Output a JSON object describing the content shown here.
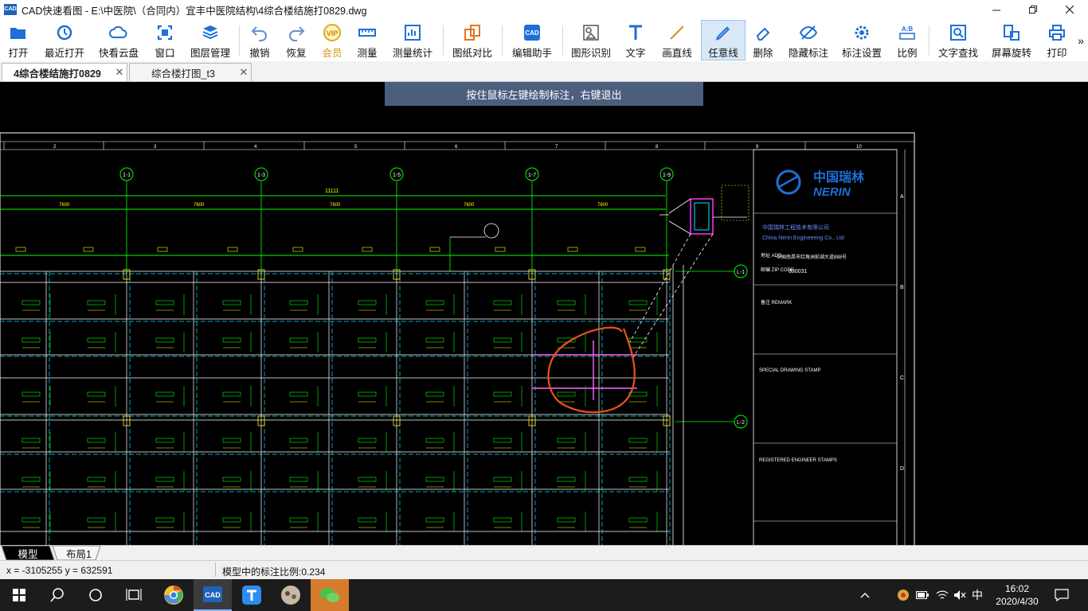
{
  "window": {
    "title": "CAD快速看图 - E:\\中医院\\（合同内）宜丰中医院结构\\4综合楼结施打0829.dwg",
    "logo": "CAD"
  },
  "toolbar": {
    "open": "打开",
    "recent": "最近打开",
    "cloud": "快看云盘",
    "window": "窗口",
    "layers": "图层管理",
    "undo": "撤销",
    "redo": "恢复",
    "member": "会员",
    "measure": "测量",
    "measure_stats": "测量统计",
    "compare": "图纸对比",
    "edit_helper": "编辑助手",
    "shape_recognize": "图形识别",
    "text": "文字",
    "line": "画直线",
    "freehand": "任意线",
    "erase": "删除",
    "hide_annot": "隐藏标注",
    "annot_settings": "标注设置",
    "scale": "比例",
    "text_find": "文字查找",
    "rotate": "屏幕旋转",
    "print": "打印",
    "more": "»"
  },
  "tabs": [
    {
      "label": "4综合楼结施打0829",
      "active": true
    },
    {
      "label": "综合楼打图_t3",
      "active": false
    }
  ],
  "canvas": {
    "hint": "按住鼠标左键绘制标注，右键退出",
    "grid_numbers": [
      "2",
      "3",
      "4",
      "5",
      "6",
      "7",
      "8",
      "9",
      "10"
    ],
    "axis_bubbles": [
      "1-1",
      "1-3",
      "1-5",
      "1-7",
      "1-9"
    ],
    "side_bubbles": [
      "L-1",
      "L-2"
    ],
    "dims_top": [
      "7600",
      "7600",
      "7600",
      "7600"
    ],
    "title_block": {
      "company_cn": "中国瑞林",
      "company_en": "NERIN",
      "full_cn": "中国瑞林工程技术有限公司",
      "full_en": "China Nerin Engineering Co., Ltd",
      "addr_label": "地址 ADD.",
      "addr": "中国南昌市红角洲前湖大道888号",
      "zip_label": "邮编 ZIP CODE",
      "zip": "330031",
      "remark_label": "备注 REMARK",
      "special_stamp": "SPECIAL DRAWING STAMP",
      "reg_stamp": "REGISTERED ENGINEER STAMPS",
      "rows": [
        "A",
        "B",
        "C",
        "D"
      ]
    }
  },
  "layout_tabs": [
    "模型",
    "布局1"
  ],
  "status": {
    "coords": "x = -3105255  y = 632591",
    "scale": "模型中的标注比例:0.234"
  },
  "taskbar": {
    "ime": "中",
    "time": "16:02",
    "date": "2020/4/30"
  },
  "colors": {
    "accent": "#1e6fd9",
    "cad_green": "#00ff00",
    "cad_cyan": "#00e5ff",
    "cad_yellow": "#ffff00",
    "annot_orange": "#e8531d",
    "hint_bg": "#4c5e7e"
  }
}
